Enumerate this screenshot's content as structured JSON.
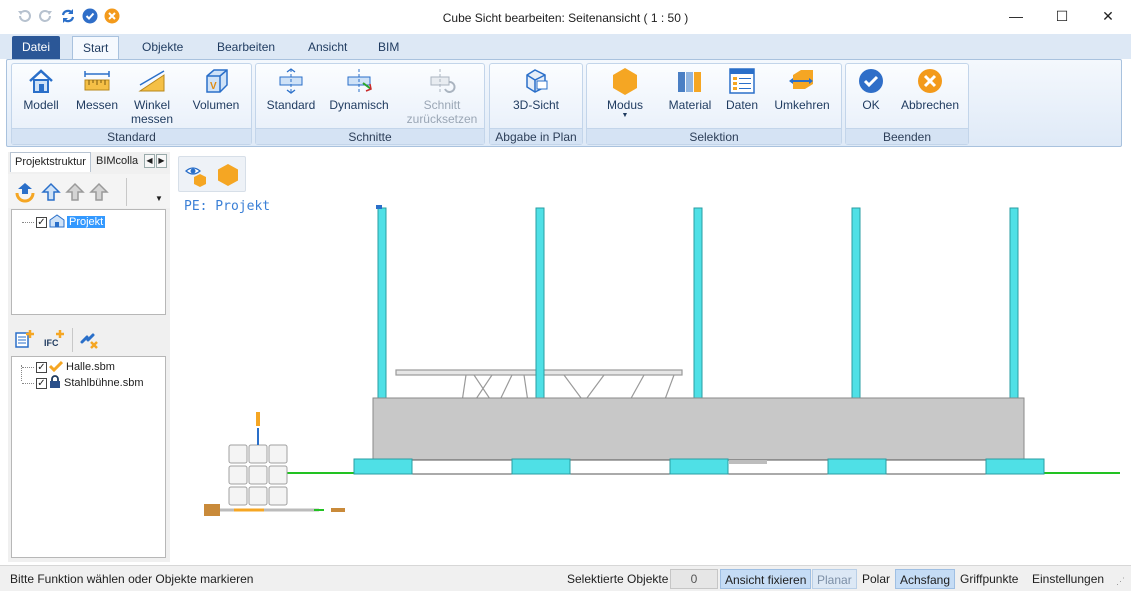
{
  "window": {
    "title": "Cube Sicht bearbeiten: Seitenansicht ( 1 : 50 )",
    "controls": [
      "—",
      "☐",
      "✕"
    ]
  },
  "ribbon": {
    "tabs": [
      "Datei",
      "Start",
      "Objekte",
      "Bearbeiten",
      "Ansicht",
      "BIM"
    ],
    "active_tab": "Start",
    "groups": {
      "standard": {
        "label": "Standard",
        "buttons": [
          "Modell",
          "Messen",
          "Winkel messen",
          "Volumen"
        ]
      },
      "schnitte": {
        "label": "Schnitte",
        "buttons": [
          "Standard",
          "Dynamisch",
          "Schnitt zurücksetzen"
        ]
      },
      "abgabe": {
        "label": "Abgabe in Plan",
        "buttons": [
          "3D-Sicht"
        ]
      },
      "selektion": {
        "label": "Selektion",
        "buttons": [
          "Modus",
          "Material",
          "Daten",
          "Umkehren"
        ]
      },
      "beenden": {
        "label": "Beenden",
        "buttons": [
          "OK",
          "Abbrechen"
        ]
      }
    },
    "winkel_line1": "Winkel",
    "winkel_line2": "messen",
    "schnitt_line1": "Schnitt",
    "schnitt_line2": "zurücksetzen"
  },
  "left_panel": {
    "tabs": [
      "Projektstruktur",
      "BIMcolla"
    ],
    "tree1": [
      {
        "label": "Projekt",
        "checked": true,
        "selected": true
      }
    ],
    "tree2": [
      {
        "label": "Halle.sbm",
        "checked": true
      },
      {
        "label": "Stahlbühne.sbm",
        "checked": true
      }
    ],
    "ifc_label": "IFC"
  },
  "canvas": {
    "pe_label": "PE: Projekt"
  },
  "status_bar": {
    "message": "Bitte Funktion wählen oder Objekte markieren",
    "selected_label": "Selektierte Objekte",
    "selected_count": "0",
    "items": [
      "Ansicht fixieren",
      "Planar",
      "Polar",
      "Achsfang",
      "Griffpunkte",
      "Einstellungen"
    ]
  },
  "colors": {
    "accent": "#2b5797",
    "column": "#4fe0e6",
    "slab": "#c8c8c8",
    "ground": "#22c222",
    "ok": "#2f6ec8",
    "cancel": "#f39a1b",
    "cube": "#f5a623"
  }
}
